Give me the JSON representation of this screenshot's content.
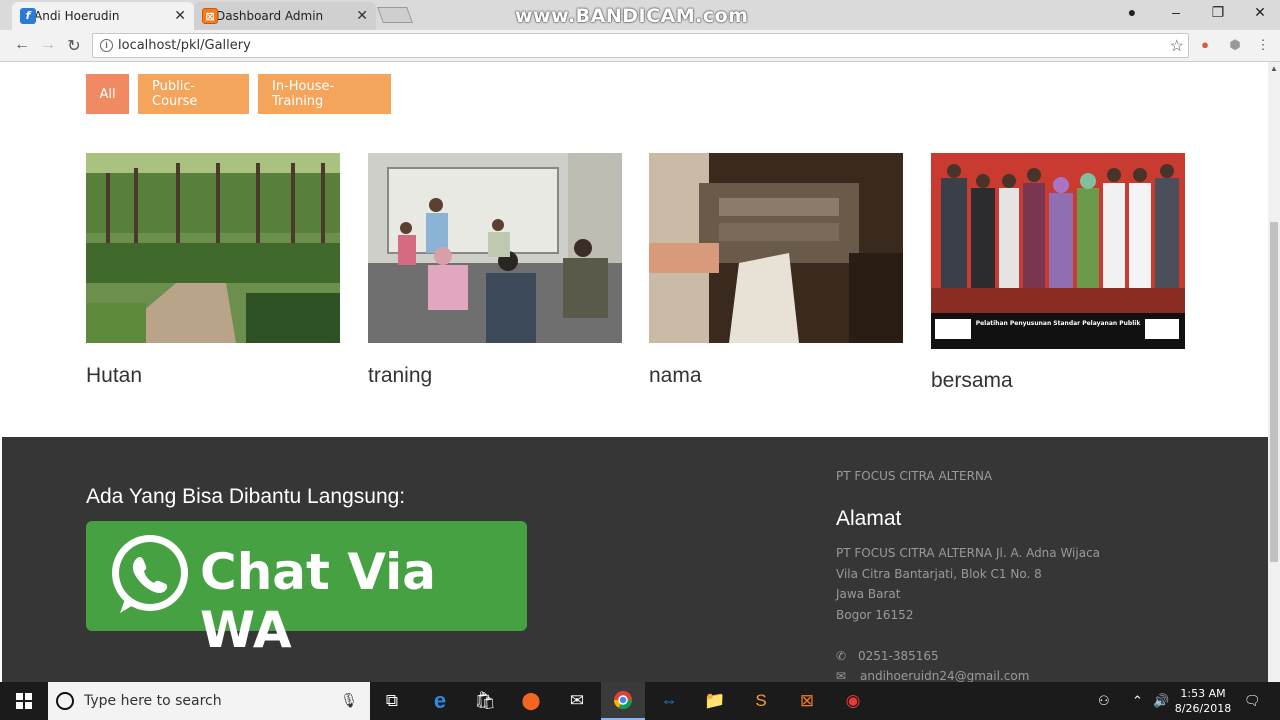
{
  "browser": {
    "tabs": [
      {
        "title": "Andi Hoerudin",
        "favicon": "f-icon"
      },
      {
        "title": "Dashboard Admin",
        "favicon": "xampp-icon"
      }
    ],
    "watermark": "www.BANDICAM.com",
    "url": "localhost/pkl/Gallery"
  },
  "filters": [
    {
      "label": "All",
      "active": true
    },
    {
      "label": "Public-Course",
      "active": false
    },
    {
      "label": "In-House-Training",
      "active": false
    }
  ],
  "gallery": [
    {
      "caption": "Hutan",
      "image": "forest-photo"
    },
    {
      "caption": "traning",
      "image": "office-meeting-photo"
    },
    {
      "caption": "nama",
      "image": "rubber-mill-photo"
    },
    {
      "caption": "bersama",
      "image": "group-photo"
    }
  ],
  "group_photo_banner": "Pelatihan Penyusunan Standar Pelayanan Publik",
  "footer": {
    "help_heading": "Ada Yang Bisa Dibantu Langsung:",
    "wa_label": "Chat Via WA",
    "company_name": "PT FOCUS CITRA ALTERNA",
    "address_heading": "Alamat",
    "address_lines": [
      "PT FOCUS CITRA ALTERNA Jl. A. Adna Wijaca",
      "Vila Citra Bantarjati, Blok C1 No. 8",
      "Jawa Barat",
      "Bogor 16152"
    ],
    "phone": "0251-385165",
    "email": "andihoeruidn24@gmail.com"
  },
  "taskbar": {
    "search_placeholder": "Type here to search",
    "time": "1:53 AM",
    "date": "8/26/2018"
  },
  "colors": {
    "filter_active": "#ef8a63",
    "filter": "#f5a45b",
    "footer_bg": "#363636",
    "wa_green": "#45a141"
  }
}
